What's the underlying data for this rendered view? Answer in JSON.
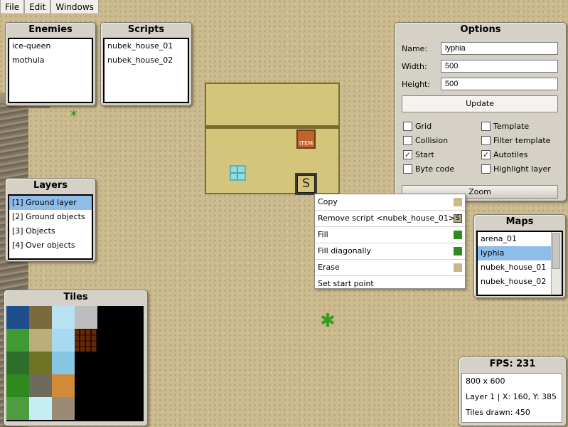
{
  "menu": {
    "items": [
      "File",
      "Edit",
      "Windows"
    ]
  },
  "enemies": {
    "title": "Enemies",
    "items": [
      "ice-queen",
      "mothula"
    ]
  },
  "scripts": {
    "title": "Scripts",
    "items": [
      "nubek_house_01",
      "nubek_house_02"
    ]
  },
  "layers": {
    "title": "Layers",
    "items": [
      "[1] Ground layer",
      "[2] Ground objects",
      "[3] Objects",
      "[4] Over objects"
    ],
    "selected": 0
  },
  "tiles": {
    "title": "Tiles"
  },
  "options": {
    "title": "Options",
    "name_label": "Name:",
    "name_value": "lyphia",
    "width_label": "Width:",
    "width_value": "500",
    "height_label": "Height:",
    "height_value": "500",
    "update_label": "Update",
    "zoom_label": "Zoom",
    "checkboxes": [
      {
        "label": "Grid",
        "checked": false
      },
      {
        "label": "Template",
        "checked": false
      },
      {
        "label": "Collision",
        "checked": false
      },
      {
        "label": "Filter template",
        "checked": false
      },
      {
        "label": "Start",
        "checked": true
      },
      {
        "label": "Autotiles",
        "checked": true
      },
      {
        "label": "Byte code",
        "checked": false
      },
      {
        "label": "Highlight layer",
        "checked": false
      }
    ]
  },
  "maps": {
    "title": "Maps",
    "items": [
      "arena_01",
      "lyphia",
      "nubek_house_01",
      "nubek_house_02"
    ],
    "selected": 1
  },
  "context_menu": {
    "items": [
      {
        "label": "Copy",
        "swatch": "#c8b88a"
      },
      {
        "label": "Remove script <nubek_house_01>",
        "swatch": "script-icon"
      },
      {
        "label": "Fill",
        "swatch": "#2f8a22"
      },
      {
        "label": "Fill diagonally",
        "swatch": "#2f8a22"
      },
      {
        "label": "Erase",
        "swatch": "#c8b88a"
      },
      {
        "label": "Set start point",
        "swatch": ""
      }
    ]
  },
  "house": {
    "item_label": "ITEM",
    "door_label": "S"
  },
  "stats": {
    "fps": "FPS: 231",
    "resolution": "800 x 600",
    "layer_info": "Layer 1 | X: 160, Y: 385",
    "tiles_drawn": "Tiles drawn: 450"
  },
  "colors": {
    "panel_bg": "#d5d1c7",
    "selection": "#8dbde8",
    "sand": "#cbbb8e"
  }
}
